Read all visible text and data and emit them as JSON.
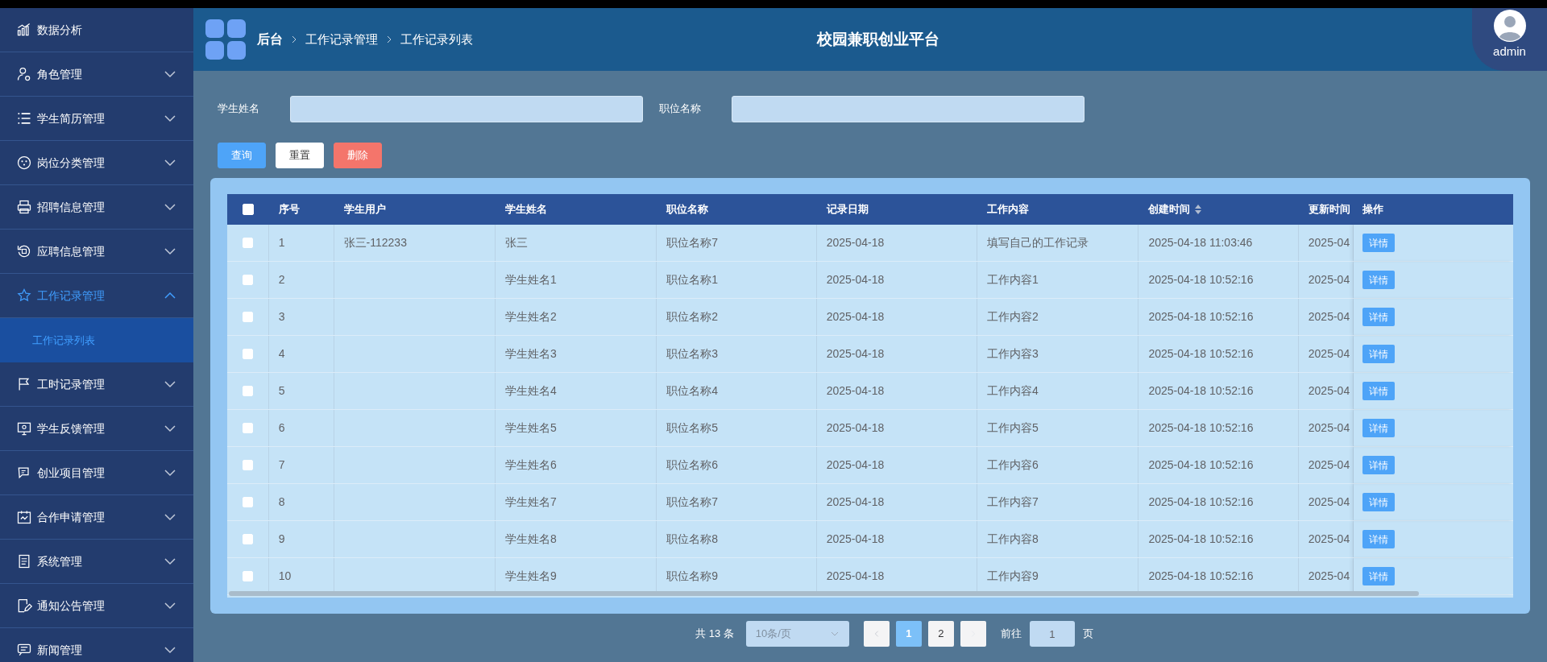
{
  "header": {
    "breadcrumb": [
      "后台",
      "工作记录管理",
      "工作记录列表"
    ],
    "title": "校园兼职创业平台",
    "user": "admin"
  },
  "sidebar": {
    "items": [
      {
        "label": "数据分析",
        "kind": "link"
      },
      {
        "label": "角色管理",
        "kind": "menu",
        "expanded": false
      },
      {
        "label": "学生简历管理",
        "kind": "menu",
        "expanded": false
      },
      {
        "label": "岗位分类管理",
        "kind": "menu",
        "expanded": false
      },
      {
        "label": "招聘信息管理",
        "kind": "menu",
        "expanded": false
      },
      {
        "label": "应聘信息管理",
        "kind": "menu",
        "expanded": false
      },
      {
        "label": "工作记录管理",
        "kind": "menu",
        "expanded": true,
        "children": [
          {
            "label": "工作记录列表",
            "selected": true
          }
        ]
      },
      {
        "label": "工时记录管理",
        "kind": "menu",
        "expanded": false
      },
      {
        "label": "学生反馈管理",
        "kind": "menu",
        "expanded": false
      },
      {
        "label": "创业项目管理",
        "kind": "menu",
        "expanded": false
      },
      {
        "label": "合作申请管理",
        "kind": "menu",
        "expanded": false
      },
      {
        "label": "系统管理",
        "kind": "menu",
        "expanded": false
      },
      {
        "label": "通知公告管理",
        "kind": "menu",
        "expanded": false
      },
      {
        "label": "新闻管理",
        "kind": "menu",
        "expanded": false
      }
    ]
  },
  "filters": [
    {
      "label": "学生姓名"
    },
    {
      "label": "职位名称"
    }
  ],
  "buttons": [
    {
      "label": "查询",
      "kind": "primary"
    },
    {
      "label": "重置",
      "kind": "default"
    },
    {
      "label": "删除",
      "kind": "danger"
    }
  ],
  "table": {
    "select_all_checked": false,
    "columns": [
      {
        "label": "序号",
        "sortable": false
      },
      {
        "label": "学生用户",
        "sortable": false
      },
      {
        "label": "学生姓名",
        "sortable": false
      },
      {
        "label": "职位名称",
        "sortable": false
      },
      {
        "label": "记录日期",
        "sortable": false
      },
      {
        "label": "工作内容",
        "sortable": false
      },
      {
        "label": "创建时间",
        "sortable": true
      },
      {
        "label": "更新时间",
        "sortable": false
      },
      {
        "label": "操作",
        "sortable": false
      }
    ],
    "rows": [
      {
        "checked": false,
        "cells": [
          "1",
          "张三-112233",
          "张三",
          "职位名称7",
          "2025-04-18",
          "填写自己的工作记录",
          "2025-04-18 11:03:46",
          "2025-04"
        ],
        "action": "详情"
      },
      {
        "checked": false,
        "cells": [
          "2",
          "",
          "学生姓名1",
          "职位名称1",
          "2025-04-18",
          "工作内容1",
          "2025-04-18 10:52:16",
          "2025-04"
        ],
        "action": "详情"
      },
      {
        "checked": false,
        "cells": [
          "3",
          "",
          "学生姓名2",
          "职位名称2",
          "2025-04-18",
          "工作内容2",
          "2025-04-18 10:52:16",
          "2025-04"
        ],
        "action": "详情"
      },
      {
        "checked": false,
        "cells": [
          "4",
          "",
          "学生姓名3",
          "职位名称3",
          "2025-04-18",
          "工作内容3",
          "2025-04-18 10:52:16",
          "2025-04"
        ],
        "action": "详情"
      },
      {
        "checked": false,
        "cells": [
          "5",
          "",
          "学生姓名4",
          "职位名称4",
          "2025-04-18",
          "工作内容4",
          "2025-04-18 10:52:16",
          "2025-04"
        ],
        "action": "详情"
      },
      {
        "checked": false,
        "cells": [
          "6",
          "",
          "学生姓名5",
          "职位名称5",
          "2025-04-18",
          "工作内容5",
          "2025-04-18 10:52:16",
          "2025-04"
        ],
        "action": "详情"
      },
      {
        "checked": false,
        "cells": [
          "7",
          "",
          "学生姓名6",
          "职位名称6",
          "2025-04-18",
          "工作内容6",
          "2025-04-18 10:52:16",
          "2025-04"
        ],
        "action": "详情"
      },
      {
        "checked": false,
        "cells": [
          "8",
          "",
          "学生姓名7",
          "职位名称7",
          "2025-04-18",
          "工作内容7",
          "2025-04-18 10:52:16",
          "2025-04"
        ],
        "action": "详情"
      },
      {
        "checked": false,
        "cells": [
          "9",
          "",
          "学生姓名8",
          "职位名称8",
          "2025-04-18",
          "工作内容8",
          "2025-04-18 10:52:16",
          "2025-04"
        ],
        "action": "详情"
      },
      {
        "checked": false,
        "cells": [
          "10",
          "",
          "学生姓名9",
          "职位名称9",
          "2025-04-18",
          "工作内容9",
          "2025-04-18 10:52:16",
          "2025-04"
        ],
        "action": "详情"
      }
    ]
  },
  "pagination": {
    "total": "共 13 条",
    "page_size": "10条/页",
    "pages": [
      {
        "label": "1",
        "selected": true
      },
      {
        "label": "2",
        "selected": false
      }
    ],
    "goto_label": "前往",
    "goto_value": "1",
    "goto_suffix": "页"
  }
}
